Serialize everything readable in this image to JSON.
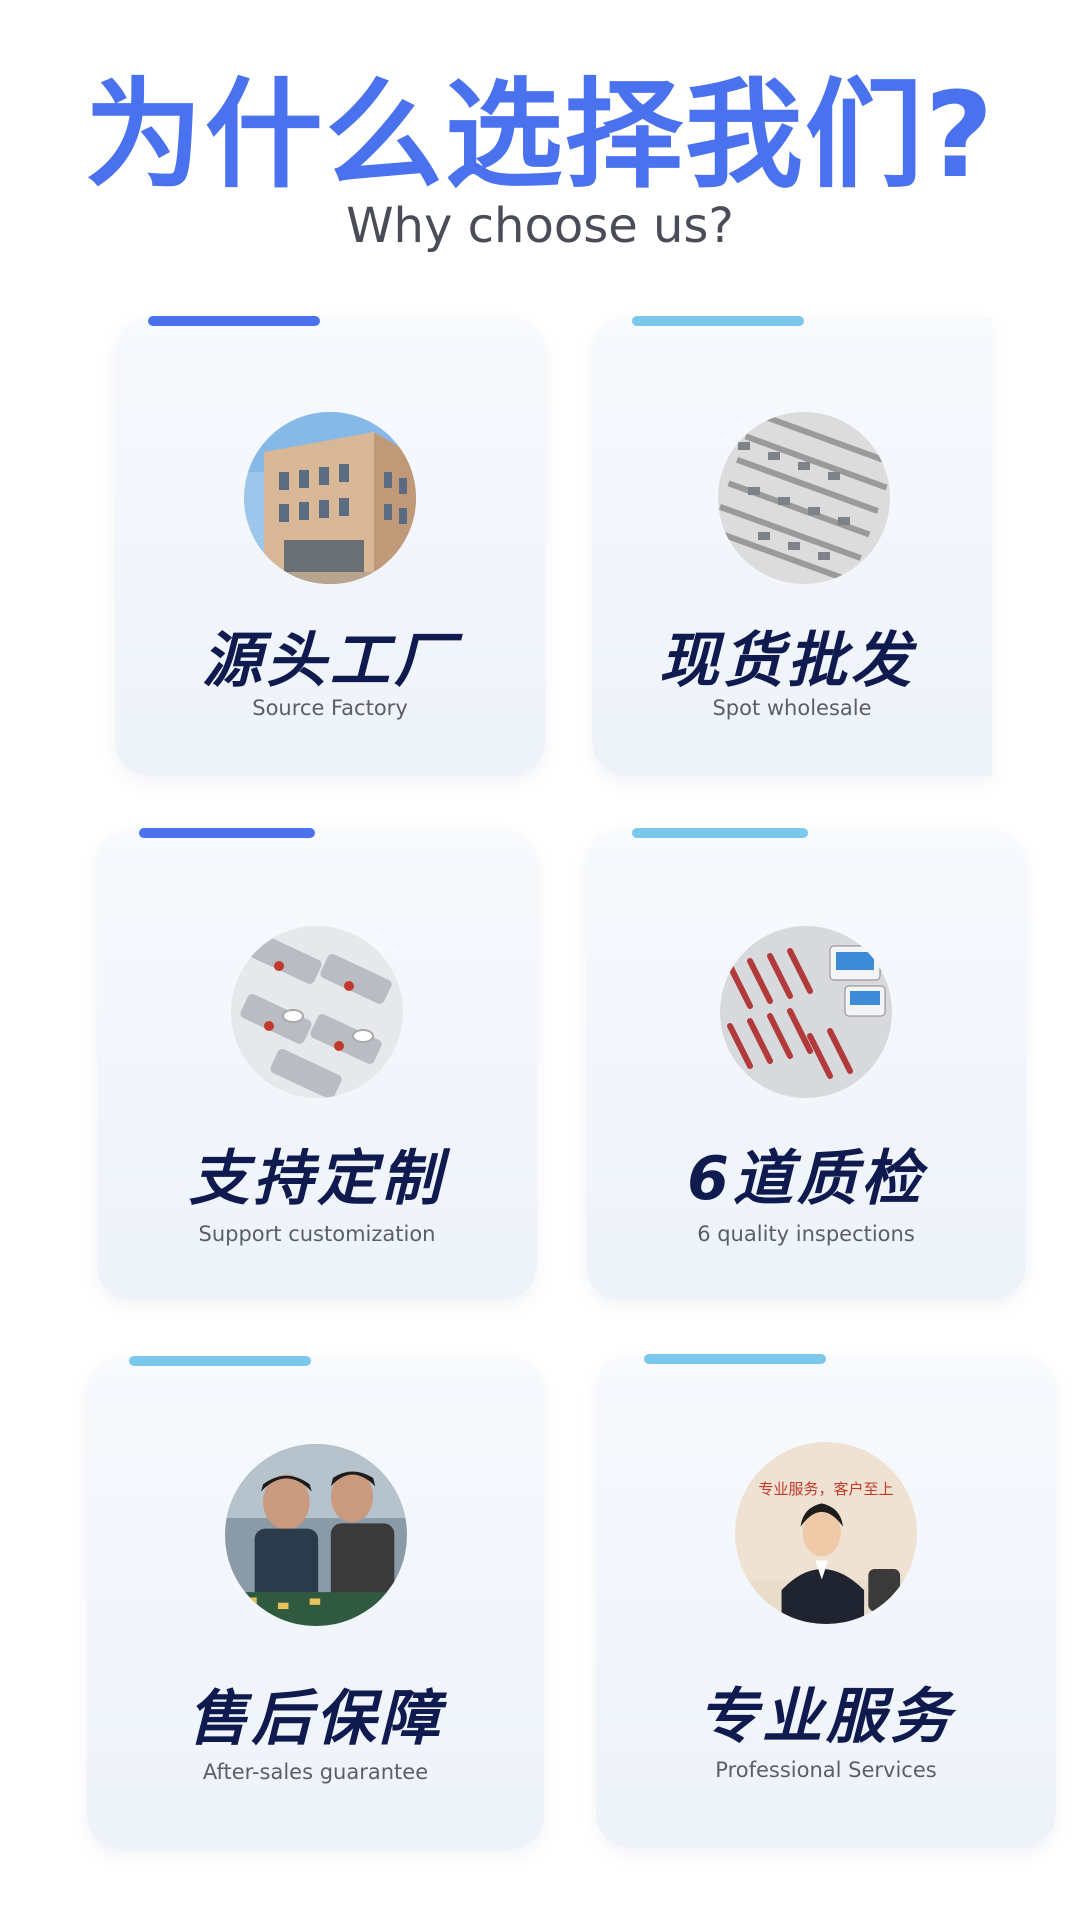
{
  "header": {
    "title": "为什么选择我们?",
    "subtitle": "Why choose us?"
  },
  "colors": {
    "title": "#4a72ee",
    "accent_bar_blue": "#4a72ee",
    "accent_bar_light": "#7cc8ec",
    "card_title": "#0f1a4f"
  },
  "features": [
    {
      "title": "源头工厂",
      "subtitle": "Source Factory",
      "image": "factory-building-photo"
    },
    {
      "title": "现货批发",
      "subtitle": "Spot wholesale",
      "image": "usb-drives-stock-photo"
    },
    {
      "title": "支持定制",
      "subtitle": "Support customization",
      "image": "custom-usb-drives-photo"
    },
    {
      "title": "6道质检",
      "subtitle": "6 quality inspections",
      "image": "quality-testing-photo"
    },
    {
      "title": "售后保障",
      "subtitle": "After-sales guarantee",
      "image": "workers-assembly-photo"
    },
    {
      "title": "专业服务",
      "subtitle": "Professional Services",
      "image": "customer-service-photo"
    }
  ],
  "service_photo_text": "专业服务，客户至上"
}
